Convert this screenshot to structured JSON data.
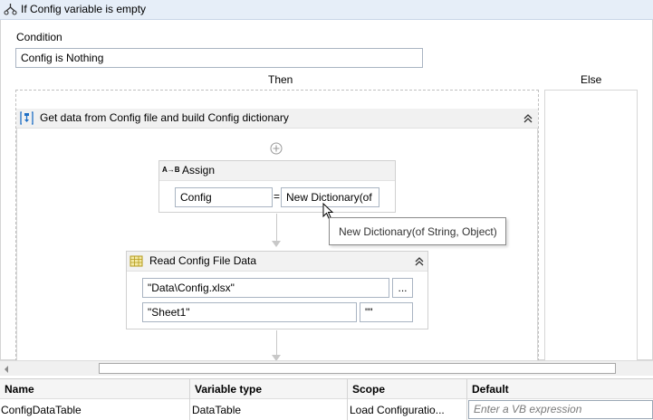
{
  "if_activity": {
    "title": "If Config variable is empty",
    "condition_label": "Condition",
    "condition_value": "Config is Nothing",
    "then_label": "Then",
    "else_label": "Else"
  },
  "sequence": {
    "title": "Get data from Config file and build Config dictionary"
  },
  "assign": {
    "title": "Assign",
    "icon_text": "A→B",
    "to": "Config",
    "equals": "=",
    "value": "New Dictionary(of"
  },
  "tooltip": {
    "text": "New Dictionary(of String, Object)"
  },
  "read_config": {
    "title": "Read Config File Data",
    "file_path": "\"Data\\Config.xlsx\"",
    "browse_label": "...",
    "sheet": "\"Sheet1\"",
    "range": "\"\""
  },
  "variables_panel": {
    "columns": [
      "Name",
      "Variable type",
      "Scope",
      "Default"
    ],
    "rows": [
      {
        "name": "ConfigDataTable",
        "type": "DataTable",
        "scope": "Load Configuratio...",
        "default_placeholder": "Enter a VB expression"
      }
    ]
  },
  "icons": {
    "if": "if-branch-icon",
    "sequence": "sequence-icon",
    "assign": "assign-icon",
    "read_config": "excel-table-icon",
    "collapse": "double-chevron-up-icon",
    "add": "plus-circle-icon"
  },
  "colors": {
    "header_blue": "#e6eef8",
    "tooltip_border": "#8a8a8a",
    "sequence_blue": "#1f6fc5"
  }
}
